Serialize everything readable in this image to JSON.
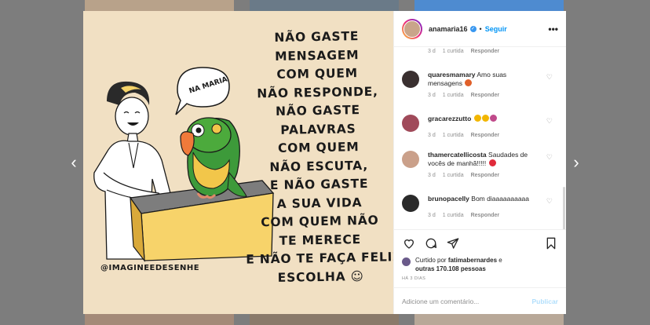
{
  "post": {
    "username": "anamaria16",
    "follow_label": "Seguir",
    "separator": "•",
    "more_icon": "more-options-icon",
    "verified_icon": "verified-badge-icon"
  },
  "image": {
    "lines": [
      "NÃO GASTE",
      "MENSAGEM",
      "COM QUEM",
      "NÃO RESPONDE,",
      "NÃO GASTE",
      "PALAVRAS",
      "COM QUEM",
      "NÃO ESCUTA,",
      "E NÃO GASTE",
      "A SUA VIDA",
      "COM QUEM NÃO",
      "TE MERECE",
      "E NÃO TE FAÇA FELIZ",
      "ESCOLHA ☺"
    ],
    "bubble": "NA MARIA",
    "credit": "@IMAGINEEDESENHE"
  },
  "comments": [
    {
      "user": "",
      "text": "",
      "time": "3 d",
      "likes": "1 curtida",
      "reply": "Responder",
      "avatar_color": "#9a8a7a"
    },
    {
      "user": "quaresmamary",
      "text": "Amo suas mensagens",
      "emoji_color": "#e0602a",
      "time": "3 d",
      "likes": "1 curtida",
      "reply": "Responder",
      "avatar_color": "#3a3030"
    },
    {
      "user": "gracarezzutto",
      "text": "",
      "emoji_colors": [
        "#f2b600",
        "#f2b600",
        "#c04a8a"
      ],
      "time": "3 d",
      "likes": "1 curtida",
      "reply": "Responder",
      "avatar_color": "#a04a5a"
    },
    {
      "user": "thamercatellicosta",
      "text": "Saudades de vocês de manhã!!!!!",
      "emoji_color": "#e02a3a",
      "time": "3 d",
      "likes": "1 curtida",
      "reply": "Responder",
      "avatar_color": "#caa08a"
    },
    {
      "user": "brunopacelly",
      "text": "Bom diaaaaaaaaaa",
      "time": "3 d",
      "likes": "1 curtida",
      "reply": "Responder",
      "avatar_color": "#2a2a2a"
    }
  ],
  "actions": {
    "like_icon": "heart-icon",
    "comment_icon": "comment-icon",
    "share_icon": "share-icon",
    "save_icon": "bookmark-icon"
  },
  "likes": {
    "prefix": "Curtido por",
    "user": "fatimabernardes",
    "middle": "e",
    "others": "outras 170.108 pessoas"
  },
  "time_ago": "HÁ 3 DIAS",
  "add_comment": {
    "placeholder": "Adicione um comentário...",
    "publish_label": "Publicar"
  },
  "nav": {
    "prev": "‹",
    "next": "›"
  }
}
